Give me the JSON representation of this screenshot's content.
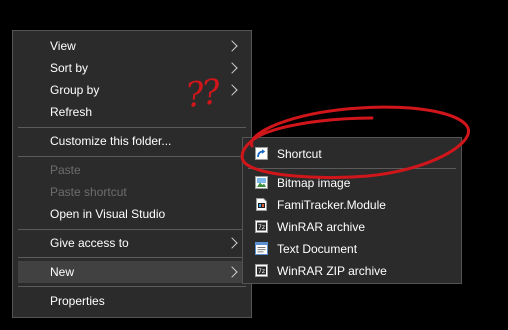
{
  "context_menu": {
    "items": [
      {
        "label": "View",
        "has_submenu": true,
        "disabled": false
      },
      {
        "label": "Sort by",
        "has_submenu": true,
        "disabled": false
      },
      {
        "label": "Group by",
        "has_submenu": true,
        "disabled": false
      },
      {
        "label": "Refresh",
        "has_submenu": false,
        "disabled": false
      },
      {
        "label": "Customize this folder...",
        "has_submenu": false,
        "disabled": false
      },
      {
        "label": "Paste",
        "has_submenu": false,
        "disabled": true
      },
      {
        "label": "Paste shortcut",
        "has_submenu": false,
        "disabled": true
      },
      {
        "label": "Open in Visual Studio",
        "has_submenu": false,
        "disabled": false
      },
      {
        "label": "Give access to",
        "has_submenu": true,
        "disabled": false
      },
      {
        "label": "New",
        "has_submenu": true,
        "disabled": false,
        "highlighted": true
      },
      {
        "label": "Properties",
        "has_submenu": false,
        "disabled": false
      }
    ]
  },
  "new_submenu": {
    "items": [
      {
        "label": "Shortcut",
        "icon": "shortcut-icon"
      },
      {
        "label": "Bitmap image",
        "icon": "bitmap-image-icon"
      },
      {
        "label": "FamiTracker.Module",
        "icon": "famitracker-file-icon"
      },
      {
        "label": "WinRAR archive",
        "icon": "winrar-archive-icon"
      },
      {
        "label": "Text Document",
        "icon": "text-document-icon"
      },
      {
        "label": "WinRAR ZIP archive",
        "icon": "winrar-zip-icon"
      }
    ]
  },
  "annotation": {
    "text": "??",
    "color": "#d0161b"
  },
  "colors": {
    "background": "#000000",
    "menu_background": "#2b2b2b",
    "menu_border": "#545454",
    "highlight": "#414141",
    "text": "#ffffff",
    "disabled_text": "#6d6d6d"
  }
}
